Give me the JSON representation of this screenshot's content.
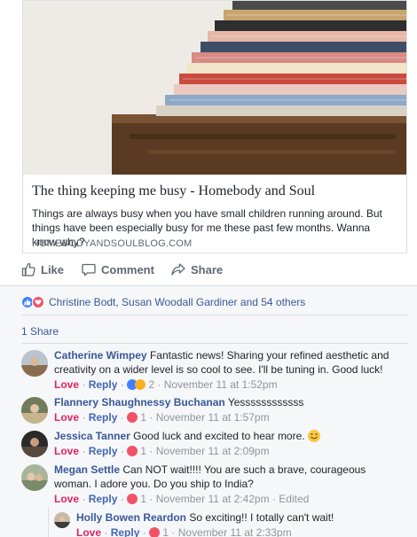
{
  "post": {
    "link_title": "The thing keeping me busy - Homebody and Soul",
    "link_description": "Things are always busy when you have small children running around. But things have been especially busy for me these past few months. Wanna know why?",
    "link_domain": "HOMEBODYANDSOULBLOG.COM"
  },
  "actions": {
    "like": "Like",
    "comment": "Comment",
    "share": "Share"
  },
  "reactions": {
    "text": "Christine Bodt, Susan Woodall Gardiner and 54 others"
  },
  "shares": "1 Share",
  "comments": [
    {
      "author": "Catherine Wimpey",
      "text": "Fantastic news! Sharing your refined aesthetic and creativity on a wider level is so cool to see. I'll be tuning in. Good luck!",
      "love": "Love",
      "reply": "Reply",
      "reaction_count": "2",
      "timestamp": "November 11 at 1:52pm"
    },
    {
      "author": "Flannery Shaughnessy Buchanan",
      "text": "Yessssssssssss",
      "love": "Love",
      "reply": "Reply",
      "reaction_count": "1",
      "timestamp": "November 11 at 1:57pm"
    },
    {
      "author": "Jessica Tanner",
      "text": "Good luck and excited to hear more.",
      "love": "Love",
      "reply": "Reply",
      "reaction_count": "1",
      "timestamp": "November 11 at 2:09pm"
    },
    {
      "author": "Megan Settle",
      "text": "Can NOT wait!!!! You are such a brave, courageous woman. I adore you. Do you ship to India?",
      "love": "Love",
      "reply": "Reply",
      "reaction_count": "1",
      "timestamp": "November 11 at 2:42pm",
      "edited": "Edited"
    }
  ],
  "reply": {
    "author": "Holly Bowen Reardon",
    "text": "So exciting!! I totally can't wait!",
    "love": "Love",
    "reply": "Reply",
    "reaction_count": "1",
    "timestamp": "November 11 at 2:33pm"
  },
  "colors": {
    "link_blue": "#385898",
    "meta_gray": "#90949c",
    "love_red": "#e0245e",
    "like_blue": "#4080ff",
    "feedback_bg": "#f6f7f9"
  }
}
